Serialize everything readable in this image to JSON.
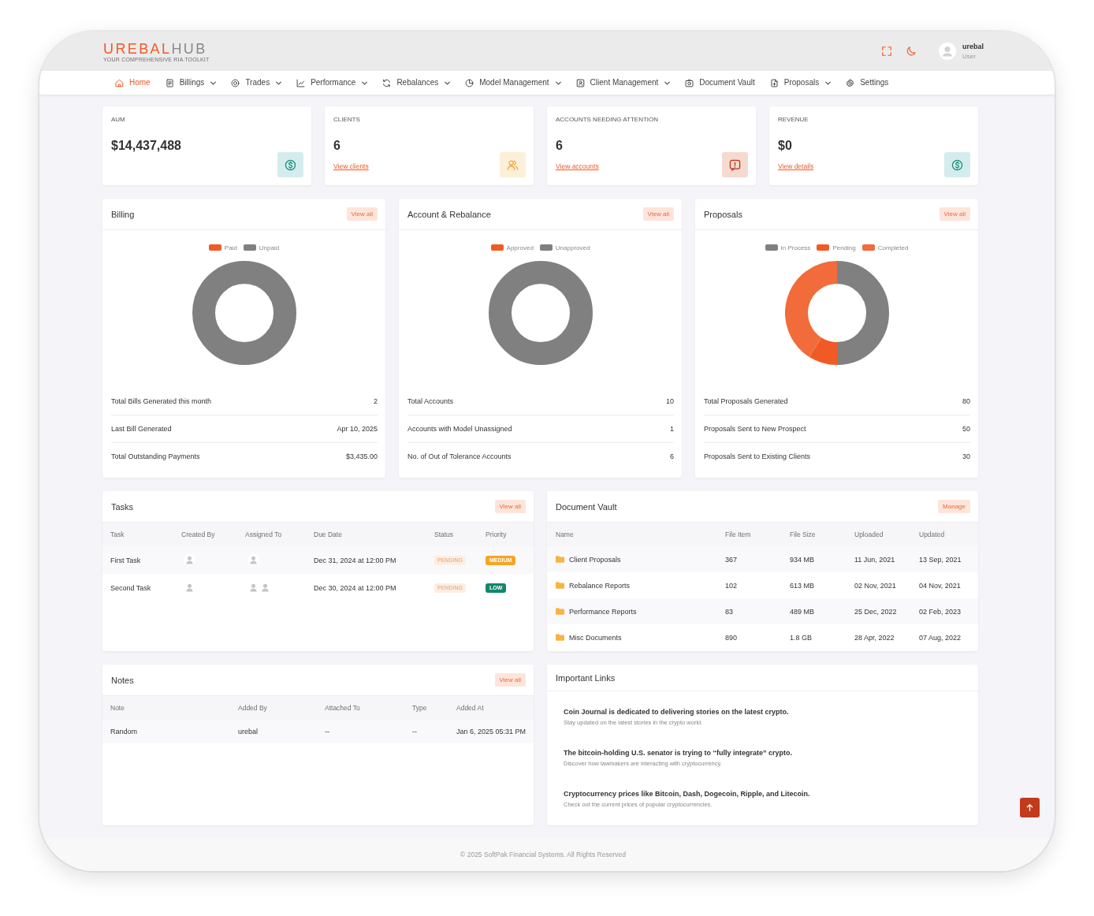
{
  "header": {
    "logo": {
      "primary": "UREBAL",
      "secondary": "HUB",
      "tagline": "YOUR COMPREHENSIVE RIA TOOLKIT"
    },
    "user": {
      "name": "urebal",
      "role": "User"
    }
  },
  "nav": [
    {
      "label": "Home",
      "selected": true,
      "has_menu": false
    },
    {
      "label": "Billings",
      "selected": false,
      "has_menu": true
    },
    {
      "label": "Trades",
      "selected": false,
      "has_menu": true
    },
    {
      "label": "Performance",
      "selected": false,
      "has_menu": true
    },
    {
      "label": "Rebalances",
      "selected": false,
      "has_menu": true
    },
    {
      "label": "Model Management",
      "selected": false,
      "has_menu": true
    },
    {
      "label": "Client Management",
      "selected": false,
      "has_menu": true
    },
    {
      "label": "Document Vault",
      "selected": false,
      "has_menu": false
    },
    {
      "label": "Proposals",
      "selected": false,
      "has_menu": true
    },
    {
      "label": "Settings",
      "selected": false,
      "has_menu": false
    }
  ],
  "stats": [
    {
      "label": "AUM",
      "value": "$14,437,488"
    },
    {
      "label": "CLIENTS",
      "value": "6",
      "link": "View clients"
    },
    {
      "label": "ACCOUNTS NEEDING ATTENTION",
      "value": "6",
      "link": "View accounts"
    },
    {
      "label": "REVENUE",
      "value": "$0",
      "link": "View details"
    }
  ],
  "summary_cards": [
    {
      "title": "Billing",
      "action": "View all",
      "legend": [
        {
          "label": "Paid",
          "color": "#f15a24"
        },
        {
          "label": "Unpaid",
          "color": "#808080"
        }
      ],
      "rows": [
        {
          "label": "Total Bills Generated this month",
          "value": "2"
        },
        {
          "label": "Last Bill Generated",
          "value": "Apr 10, 2025"
        },
        {
          "label": "Total Outstanding Payments",
          "value": "$3,435.00"
        }
      ]
    },
    {
      "title": "Account & Rebalance",
      "action": "View all",
      "legend": [
        {
          "label": "Approved",
          "color": "#f15a24"
        },
        {
          "label": "Unapproved",
          "color": "#808080"
        }
      ],
      "rows": [
        {
          "label": "Total Accounts",
          "value": "10"
        },
        {
          "label": "Accounts with Model Unassigned",
          "value": "1"
        },
        {
          "label": "No. of Out of Tolerance Accounts",
          "value": "6"
        }
      ]
    },
    {
      "title": "Proposals",
      "action": "View all",
      "legend": [
        {
          "label": "In Process",
          "color": "#808080"
        },
        {
          "label": "Pending",
          "color": "#f15a24"
        },
        {
          "label": "Completed",
          "color": "#f26b3a"
        }
      ],
      "rows": [
        {
          "label": "Total Proposals Generated",
          "value": "80"
        },
        {
          "label": "Proposals Sent to New Prospect",
          "value": "50"
        },
        {
          "label": "Proposals Sent to Existing Clients",
          "value": "30"
        }
      ]
    }
  ],
  "tasks": {
    "title": "Tasks",
    "action": "View all",
    "columns": [
      "Task",
      "Created By",
      "Assigned To",
      "Due Date",
      "Status",
      "Priority"
    ],
    "rows": [
      {
        "task": "First Task",
        "created_by": [
          {
            "kind": "avatar"
          }
        ],
        "assigned_to": [
          {
            "kind": "avatar"
          }
        ],
        "due_date": "Dec 31, 2024 at 12:00 PM",
        "status": "PENDING",
        "priority": {
          "label": "MEDIUM",
          "color": "#f5a524"
        }
      },
      {
        "task": "Second Task",
        "created_by": [
          {
            "kind": "avatar"
          }
        ],
        "assigned_to": [
          {
            "kind": "avatar"
          },
          {
            "kind": "avatar"
          }
        ],
        "due_date": "Dec 30, 2024 at 12:00 PM",
        "status": "PENDING",
        "priority": {
          "label": "LOW",
          "color": "#14866b"
        }
      }
    ]
  },
  "document_vault": {
    "title": "Document Vault",
    "action": "Manage",
    "columns": [
      "Name",
      "File Item",
      "File Size",
      "Uploaded",
      "Updated"
    ],
    "rows": [
      {
        "name": "Client Proposals",
        "file_item": "367",
        "file_size": "934 MB",
        "uploaded": "11 Jun, 2021",
        "updated": "13 Sep, 2021"
      },
      {
        "name": "Rebalance Reports",
        "file_item": "102",
        "file_size": "613 MB",
        "uploaded": "02 Nov, 2021",
        "updated": "04 Nov, 2021"
      },
      {
        "name": "Performance Reports",
        "file_item": "83",
        "file_size": "489 MB",
        "uploaded": "25 Dec, 2022",
        "updated": "02 Feb, 2023"
      },
      {
        "name": "Misc Documents",
        "file_item": "890",
        "file_size": "1.8 GB",
        "uploaded": "28 Apr, 2022",
        "updated": "07 Aug, 2022"
      }
    ]
  },
  "notes": {
    "title": "Notes",
    "action": "View all",
    "columns": [
      "Note",
      "Added By",
      "Attached To",
      "Type",
      "Added At"
    ],
    "rows": [
      {
        "note": "Random",
        "added_by": "urebal",
        "attached_to": "--",
        "type": "--",
        "added_at": "Jan 6, 2025 05:31 PM"
      }
    ]
  },
  "important_links": {
    "title": "Important Links",
    "items": [
      {
        "title": "Coin Journal is dedicated to delivering stories on the latest crypto.",
        "description": "Stay updated on the latest stories in the crypto world."
      },
      {
        "title": "The bitcoin-holding U.S. senator is trying to “fully integrate” crypto.",
        "description": "Discover how lawmakers are interacting with cryptocurrency."
      },
      {
        "title": "Cryptocurrency prices like Bitcoin, Dash, Dogecoin, Ripple, and Litecoin.",
        "description": "Check out the current prices of popular cryptocurrencies."
      }
    ]
  },
  "footer": {
    "text": "© 2025 SoftPak Financial Systems. All Rights Reserved"
  }
}
